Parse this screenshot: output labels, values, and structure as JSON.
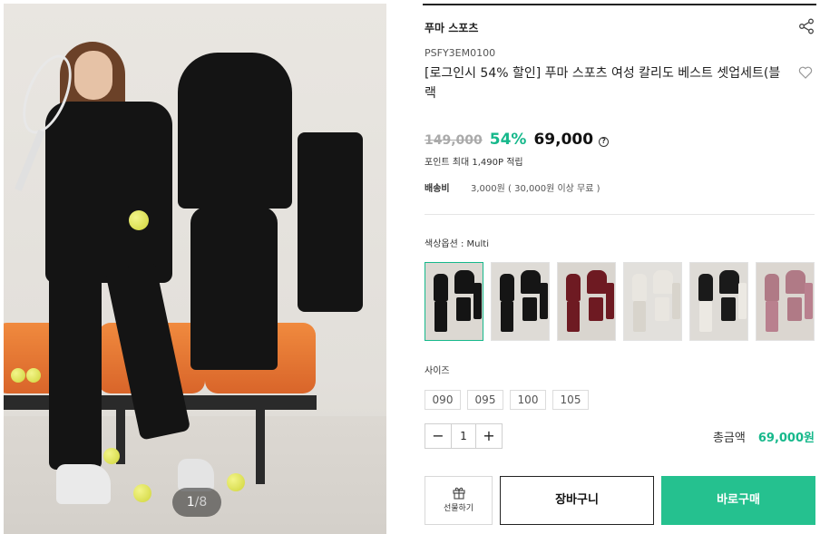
{
  "gallery": {
    "current": "1",
    "separator": "/",
    "total": "8",
    "image_label": "main-product-photo"
  },
  "product": {
    "brand": "푸마 스포츠",
    "code": "PSFY3EM0100",
    "title": "[로그인시 54% 할인] 푸마 스포츠 여성 칼리도 베스트 셋업세트(블랙",
    "original_price": "149,000",
    "discount_rate": "54%",
    "sale_price": "69,000",
    "help_icon": "?",
    "points": "포인트 최대 1,490P 적립",
    "shipping_label": "배송비",
    "shipping_value": "3,000원 ( 30,000원 이상 무료 )"
  },
  "options": {
    "color_label": "색상옵션 : Multi",
    "swatches": [
      {
        "name": "swatch-1",
        "bg": "#dcd8d2",
        "top": "#141414",
        "bottom": "#141414"
      },
      {
        "name": "swatch-2",
        "bg": "#dedbd6",
        "top": "#151515",
        "bottom": "#151515"
      },
      {
        "name": "swatch-3",
        "bg": "#d9d5cf",
        "top": "#6e1a22",
        "bottom": "#6e1a22"
      },
      {
        "name": "swatch-4",
        "bg": "#e2e0dc",
        "top": "#e9e6e0",
        "bottom": "#d8d4cc"
      },
      {
        "name": "swatch-5",
        "bg": "#dedbd6",
        "top": "#1a1a1a",
        "bottom": "#ece9e3"
      },
      {
        "name": "swatch-6",
        "bg": "#dbd6d0",
        "top": "#b07a86",
        "bottom": "#b9808e"
      }
    ],
    "size_label": "사이즈",
    "sizes": [
      "090",
      "095",
      "100",
      "105"
    ]
  },
  "purchase": {
    "minus": "−",
    "quantity": "1",
    "plus": "+",
    "total_label": "총금액",
    "total_value": "69,000원",
    "gift_label": "선물하기",
    "cart_label": "장바구니",
    "buy_label": "바로구매"
  },
  "colors": {
    "accent": "#16b88b",
    "buy_button": "#25c18f"
  }
}
